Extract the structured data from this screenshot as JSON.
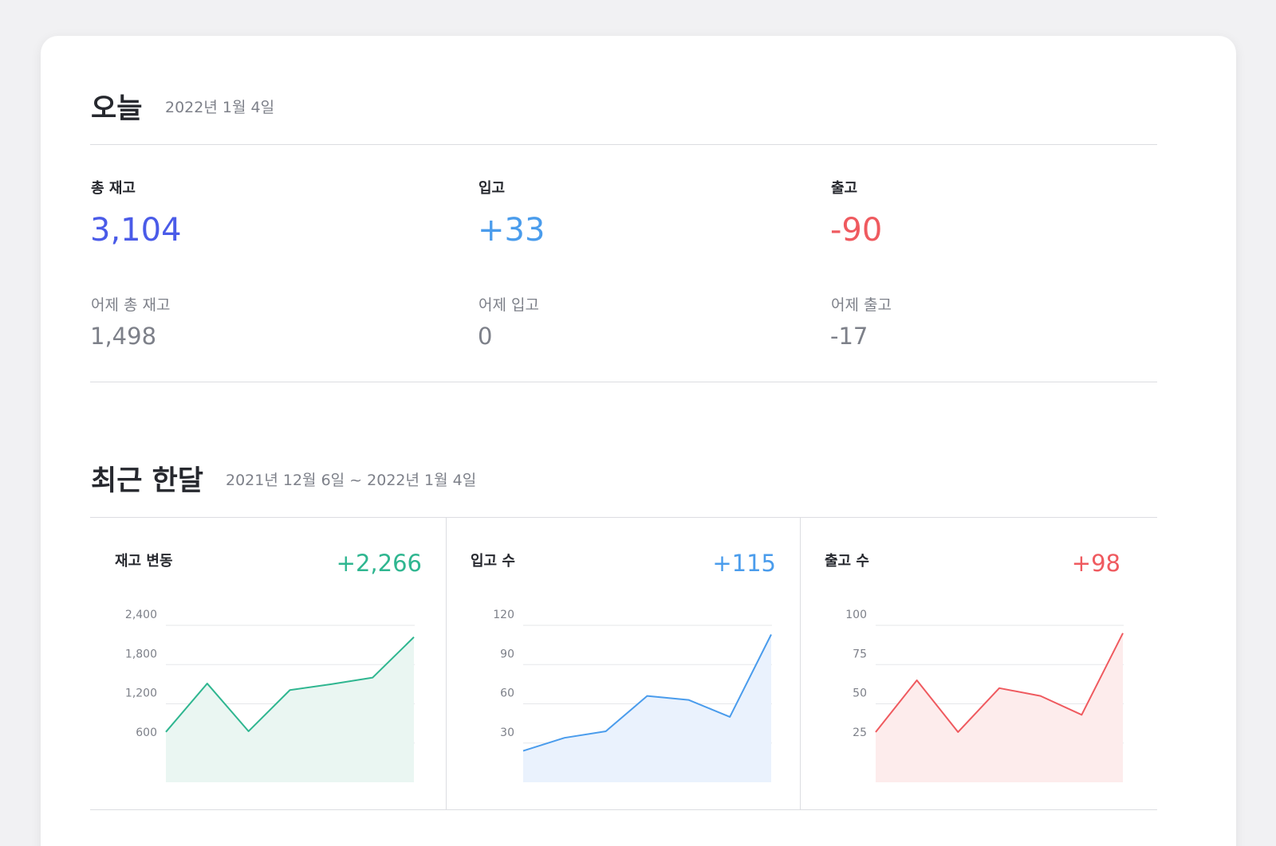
{
  "today": {
    "title": "오늘",
    "date": "2022년 1월 4일",
    "stats": [
      {
        "label": "총 재고",
        "value": "3,104",
        "prev_label": "어제 총 재고",
        "prev_value": "1,498"
      },
      {
        "label": "입고",
        "value": "+33",
        "prev_label": "어제 입고",
        "prev_value": "0"
      },
      {
        "label": "출고",
        "value": "-90",
        "prev_label": "어제 출고",
        "prev_value": "-17"
      }
    ]
  },
  "month": {
    "title": "최근 한달",
    "date_range": "2021년 12월 6일 ~ 2022년 1월 4일",
    "panels": [
      {
        "title": "재고 변동",
        "total": "+2,266"
      },
      {
        "title": "입고 수",
        "total": "+115"
      },
      {
        "title": "출고 수",
        "total": "+98"
      }
    ]
  },
  "colors": {
    "total_stock": "#4a5be8",
    "inbound": "#4a9cec",
    "outbound": "#ef5a5f",
    "stock_change": "#2fb690"
  },
  "chart_data": [
    {
      "type": "area",
      "title": "재고 변동",
      "yticks": [
        600,
        1200,
        1800,
        2400
      ],
      "ylim": [
        0,
        2400
      ],
      "values": [
        770,
        1510,
        780,
        1410,
        1500,
        1600,
        2220
      ],
      "color": "#2fb690",
      "fill": "#eaf6f2"
    },
    {
      "type": "area",
      "title": "입고 수",
      "yticks": [
        30,
        60,
        90,
        120
      ],
      "ylim": [
        0,
        120
      ],
      "values": [
        24,
        34,
        39,
        66,
        63,
        50,
        113
      ],
      "color": "#4a9cec",
      "fill": "#eaf2fd"
    },
    {
      "type": "area",
      "title": "출고 수",
      "yticks": [
        25,
        50,
        75,
        100
      ],
      "ylim": [
        0,
        100
      ],
      "values": [
        32,
        65,
        32,
        60,
        55,
        43,
        95
      ],
      "color": "#ef5a5f",
      "fill": "#fdecec"
    }
  ]
}
